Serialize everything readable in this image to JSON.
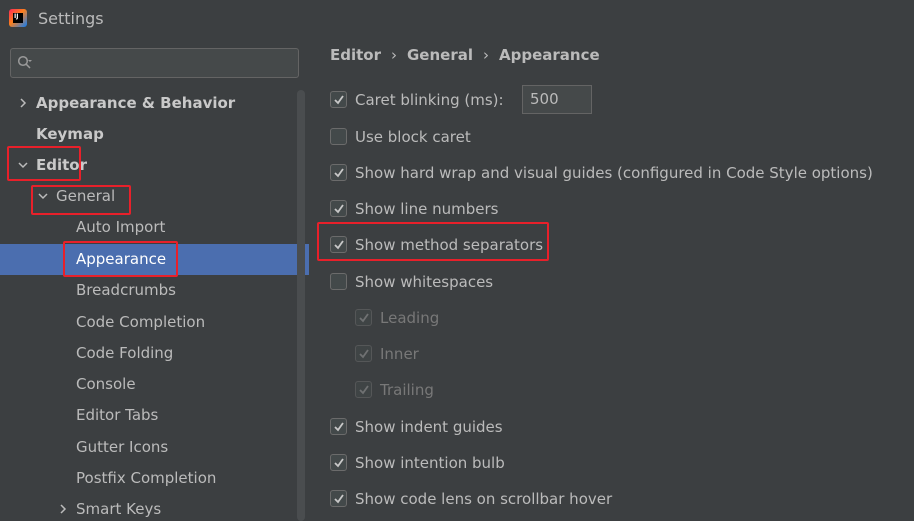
{
  "window": {
    "title": "Settings"
  },
  "search": {
    "placeholder": ""
  },
  "tree": {
    "appearance_behavior": "Appearance & Behavior",
    "keymap": "Keymap",
    "editor": "Editor",
    "general": "General",
    "children": [
      "Auto Import",
      "Appearance",
      "Breadcrumbs",
      "Code Completion",
      "Code Folding",
      "Console",
      "Editor Tabs",
      "Gutter Icons",
      "Postfix Completion",
      "Smart Keys"
    ],
    "selected": "Appearance"
  },
  "breadcrumb": [
    "Editor",
    "General",
    "Appearance"
  ],
  "options": {
    "caret_blinking": {
      "label": "Caret blinking (ms):",
      "checked": true,
      "value": "500"
    },
    "block_caret": {
      "label": "Use block caret",
      "checked": false
    },
    "hard_wrap": {
      "label": "Show hard wrap and visual guides (configured in Code Style options)",
      "checked": true
    },
    "line_numbers": {
      "label": "Show line numbers",
      "checked": true
    },
    "method_separators": {
      "label": "Show method separators",
      "checked": true
    },
    "whitespaces": {
      "label": "Show whitespaces",
      "checked": false
    },
    "leading": {
      "label": "Leading",
      "checked": true,
      "disabled": true
    },
    "inner": {
      "label": "Inner",
      "checked": true,
      "disabled": true
    },
    "trailing": {
      "label": "Trailing",
      "checked": true,
      "disabled": true
    },
    "indent_guides": {
      "label": "Show indent guides",
      "checked": true
    },
    "intention_bulb": {
      "label": "Show intention bulb",
      "checked": true
    },
    "code_lens": {
      "label": "Show code lens on scrollbar hover",
      "checked": true
    }
  },
  "colors": {
    "background": "#3c3f41",
    "selection": "#4b6eaf",
    "highlight": "#e8202a",
    "text": "#bbbbbb"
  }
}
